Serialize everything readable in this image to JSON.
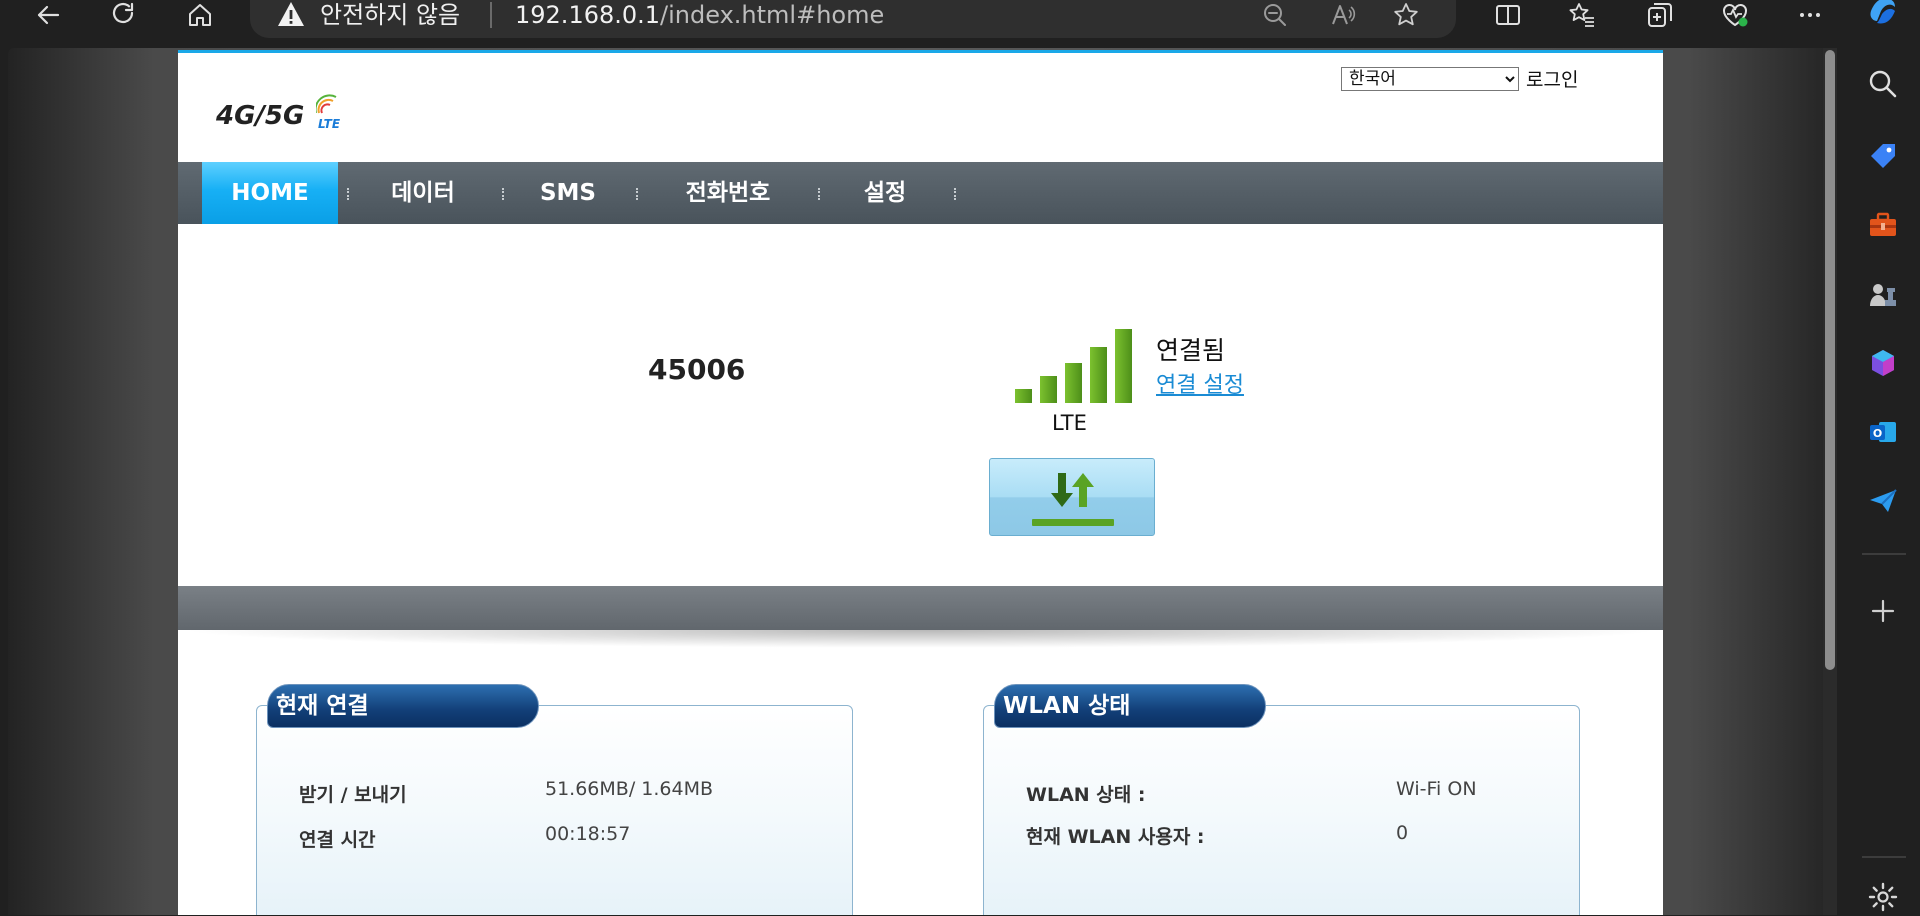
{
  "browser": {
    "security_label": "안전하지 않음",
    "url_host": "192.168.0.1",
    "url_path": "/index.html#home"
  },
  "header": {
    "logo_text": "4G/5G",
    "logo_sub": "LTE",
    "language_selected": "한국어",
    "login_label": "로그인"
  },
  "nav": {
    "items": [
      {
        "label": "HOME"
      },
      {
        "label": "데이터"
      },
      {
        "label": "SMS"
      },
      {
        "label": "전화번호"
      },
      {
        "label": "설정"
      }
    ]
  },
  "status": {
    "provider": "45006",
    "connection_state": "연결됨",
    "connection_settings_link": "연결 설정",
    "network_type": "LTE",
    "signal_bars_lit": 5,
    "signal_bars_total": 5
  },
  "current_connection": {
    "title": "현재 연결",
    "rx_tx_label": "받기 / 보내기",
    "rx_tx_value": "51.66MB/ 1.64MB",
    "time_label": "연결 시간",
    "time_value": "00:18:57"
  },
  "wlan": {
    "title": "WLAN 상태",
    "state_label": "WLAN 상태 :",
    "state_value": "Wi-Fi ON",
    "users_label": "현재 WLAN 사용자 :",
    "users_value": "0"
  },
  "colors": {
    "nav_active": "#17b0f5",
    "signal_green": "#5fa521",
    "panel_title": "#123f78",
    "link": "#1a8bd4"
  }
}
